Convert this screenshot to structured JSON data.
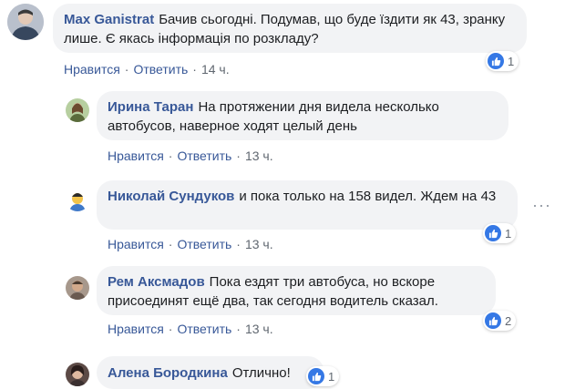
{
  "comments": [
    {
      "author": "Max Ganistrat",
      "text": "Бачив сьогодні. Подумав, що буде їздити як 43, зранку лише. Є якась інформація по розкладу?",
      "like_label": "Нравится",
      "reply_label": "Ответить",
      "time": "14 ч.",
      "reactions": "1",
      "avatar_icon": "user-avatar-icon"
    },
    {
      "author": "Ирина Таран",
      "text": "На протяжении дня видела несколько автобусов, наверное ходят целый день",
      "like_label": "Нравится",
      "reply_label": "Ответить",
      "time": "13 ч.",
      "avatar_icon": "user-avatar-icon"
    },
    {
      "author": "Николай Сундуков",
      "text": "и пока только на 158 видел. Ждем на 43",
      "like_label": "Нравится",
      "reply_label": "Ответить",
      "time": "13 ч.",
      "reactions": "1",
      "avatar_icon": "user-avatar-icon"
    },
    {
      "author": "Рем Аксмадов",
      "text": "Пока ездят три автобуса, но вскоре присоединят ещё два, так сегодня водитель сказал.",
      "like_label": "Нравится",
      "reply_label": "Ответить",
      "time": "13 ч.",
      "reactions": "2",
      "avatar_icon": "user-avatar-icon"
    },
    {
      "author": "Алена Бородкина",
      "text": "Отлично!",
      "reactions": "1",
      "avatar_icon": "user-avatar-icon"
    }
  ],
  "colors": {
    "name": "#385898",
    "bubble": "#f2f3f5",
    "meta": "#606770",
    "like": "#3578e5"
  }
}
